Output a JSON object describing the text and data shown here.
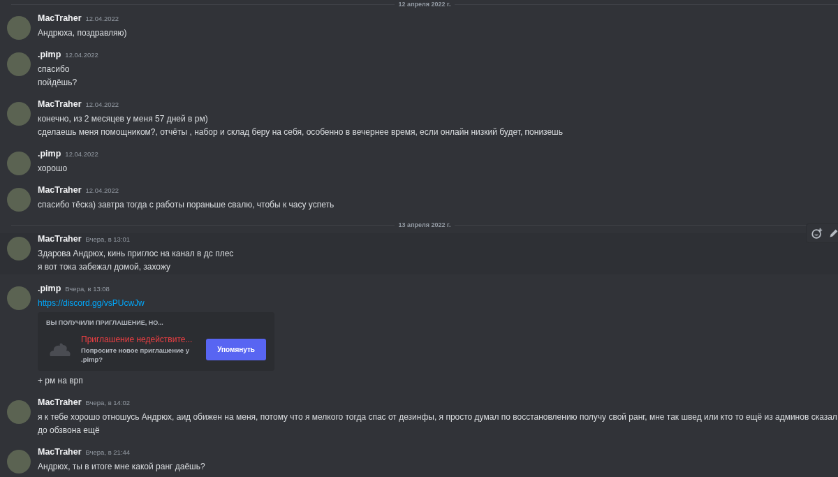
{
  "feed": [
    {
      "kind": "divider",
      "label": "12 апреля 2022 г."
    },
    {
      "kind": "message",
      "author": "MacTraher",
      "time": "12.04.2022",
      "hovered": false,
      "lines": [
        {
          "kind": "text",
          "text": "Андрюха, поздравляю)"
        }
      ]
    },
    {
      "kind": "message",
      "author": ".pimp",
      "time": "12.04.2022",
      "hovered": false,
      "lines": [
        {
          "kind": "text",
          "text": "спасибо"
        },
        {
          "kind": "text",
          "text": "пойдёшь?"
        }
      ]
    },
    {
      "kind": "message",
      "author": "MacTraher",
      "time": "12.04.2022",
      "hovered": false,
      "lines": [
        {
          "kind": "text",
          "text": "конечно, из 2 месяцев  у меня 57 дней в рм)"
        },
        {
          "kind": "text",
          "text": "сделаешь меня помощником?, отчёты , набор и склад беру на себя,  особенно в вечернее время, если онлайн низкий будет, понизешь"
        }
      ]
    },
    {
      "kind": "message",
      "author": ".pimp",
      "time": "12.04.2022",
      "hovered": false,
      "lines": [
        {
          "kind": "text",
          "text": "хорошо"
        }
      ]
    },
    {
      "kind": "message",
      "author": "MacTraher",
      "time": "12.04.2022",
      "hovered": false,
      "lines": [
        {
          "kind": "text",
          "text": "спасибо тёска) завтра тогда с работы пораньше свалю, чтобы к часу успеть"
        }
      ]
    },
    {
      "kind": "divider",
      "label": "13 апреля 2022 г."
    },
    {
      "kind": "message",
      "author": "MacTraher",
      "time": "Вчера, в 13:01",
      "hovered": true,
      "lines": [
        {
          "kind": "text",
          "text": "Здарова Андрюх, кинь приглос на канал в дс плес"
        },
        {
          "kind": "text",
          "text": "я вот тока забежал домой, захожу"
        }
      ]
    },
    {
      "kind": "message",
      "author": ".pimp",
      "time": "Вчера, в 13:08",
      "hovered": false,
      "lines": [
        {
          "kind": "link",
          "text": "https://discord.gg/vsPUcwJw"
        },
        {
          "kind": "invite",
          "heading": "ВЫ ПОЛУЧИЛИ ПРИГЛАШЕНИЕ, НО...",
          "title": "Приглашение недействите...",
          "description": "Попросите новое приглашение у .pimp?",
          "button": "Упомянуть"
        },
        {
          "kind": "text",
          "text": "+ рм на врп"
        }
      ]
    },
    {
      "kind": "message",
      "author": "MacTraher",
      "time": "Вчера, в 14:02",
      "hovered": false,
      "lines": [
        {
          "kind": "text",
          "text": "я к тебе хорошо отношусь Андрюх, аид обижен на меня,  потому что я мелкого тогда спас от дезинфы, я просто думал по восстановлению получу свой ранг, мне так швед или кто то ещё из админов сказал до обзвона ещё"
        }
      ]
    },
    {
      "kind": "message",
      "author": "MacTraher",
      "time": "Вчера, в 21:44",
      "hovered": false,
      "lines": [
        {
          "kind": "text",
          "text": "Андрюх, ты в итоге мне какой ранг даёшь?"
        }
      ]
    }
  ]
}
